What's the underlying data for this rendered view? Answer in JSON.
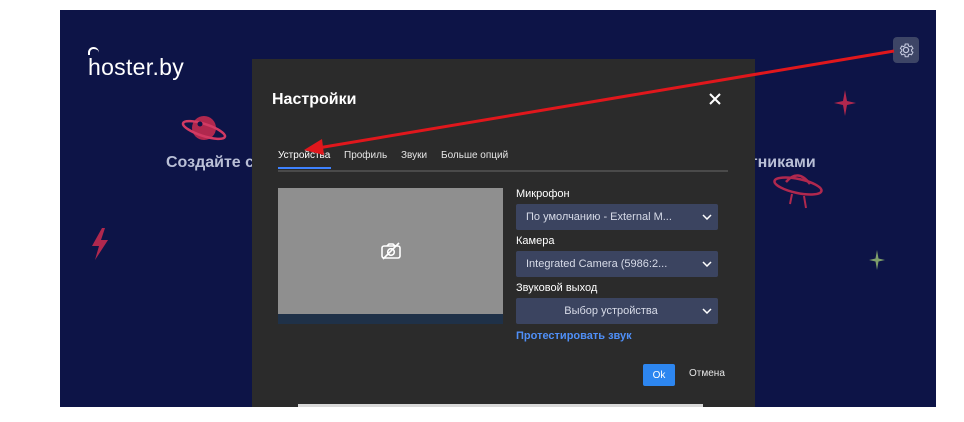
{
  "background": {
    "logo": "hoster.by",
    "headline_left": "Создайте с",
    "headline_right": "астниками"
  },
  "modal": {
    "title": "Настройки",
    "tabs": [
      {
        "label": "Устройства",
        "active": true
      },
      {
        "label": "Профиль",
        "active": false
      },
      {
        "label": "Звуки",
        "active": false
      },
      {
        "label": "Больше опций",
        "active": false
      }
    ],
    "fields": {
      "microphone": {
        "label": "Микрофон",
        "value": "По умолчанию - External M..."
      },
      "camera": {
        "label": "Камера",
        "value": "Integrated Camera (5986:2..."
      },
      "audio_output": {
        "label": "Звуковой выход",
        "value": "Выбор устройства"
      }
    },
    "test_sound_link": "Протестировать звук",
    "ok_label": "Ok",
    "cancel_label": "Отмена"
  },
  "icons": {
    "settings": "gear-icon",
    "close": "close-icon",
    "camera_off": "camera-off-icon",
    "dropdown": "chevron-down-icon"
  },
  "colors": {
    "page_bg": "#0d1447",
    "modal_bg": "#2b2b2b",
    "accent": "#2d86f0",
    "select_bg": "#3b4460",
    "deco_red": "#b0284e",
    "annotation_arrow": "#e0171c"
  }
}
